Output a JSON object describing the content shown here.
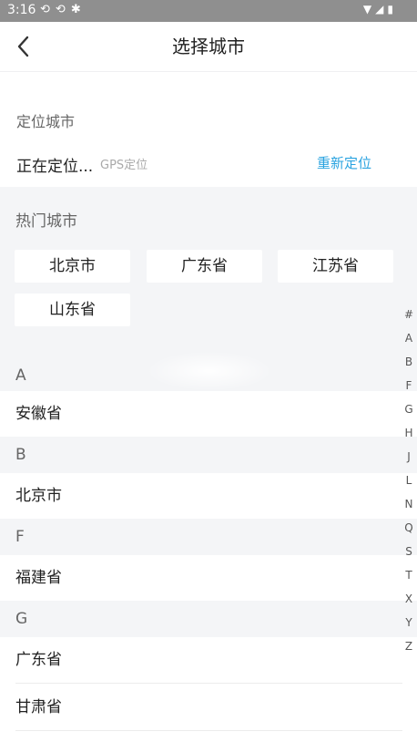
{
  "status_bar": {
    "time": "3:16",
    "left_icon_names": [
      "sync-icon",
      "sync-icon",
      "bug-icon"
    ],
    "right_icon_names": [
      "wifi-icon",
      "signal-icon",
      "battery-icon"
    ]
  },
  "nav": {
    "title": "选择城市"
  },
  "location": {
    "label": "定位城市",
    "status": "正在定位...",
    "gps": "GPS定位",
    "relocate": "重新定位"
  },
  "hot": {
    "label": "热门城市",
    "cities": [
      "北京市",
      "广东省",
      "江苏省",
      "山东省"
    ]
  },
  "groups": [
    {
      "letter": "A",
      "items": [
        "安徽省"
      ]
    },
    {
      "letter": "B",
      "items": [
        "北京市"
      ]
    },
    {
      "letter": "F",
      "items": [
        "福建省"
      ]
    },
    {
      "letter": "G",
      "items": [
        "广东省",
        "甘肃省"
      ]
    }
  ],
  "index": [
    "#",
    "A",
    "B",
    "F",
    "G",
    "H",
    "J",
    "L",
    "N",
    "Q",
    "S",
    "T",
    "X",
    "Y",
    "Z"
  ],
  "colors": {
    "accent": "#2aa3e0",
    "section_bg": "#f4f5f7",
    "status_bar": "#8f8f8f"
  }
}
